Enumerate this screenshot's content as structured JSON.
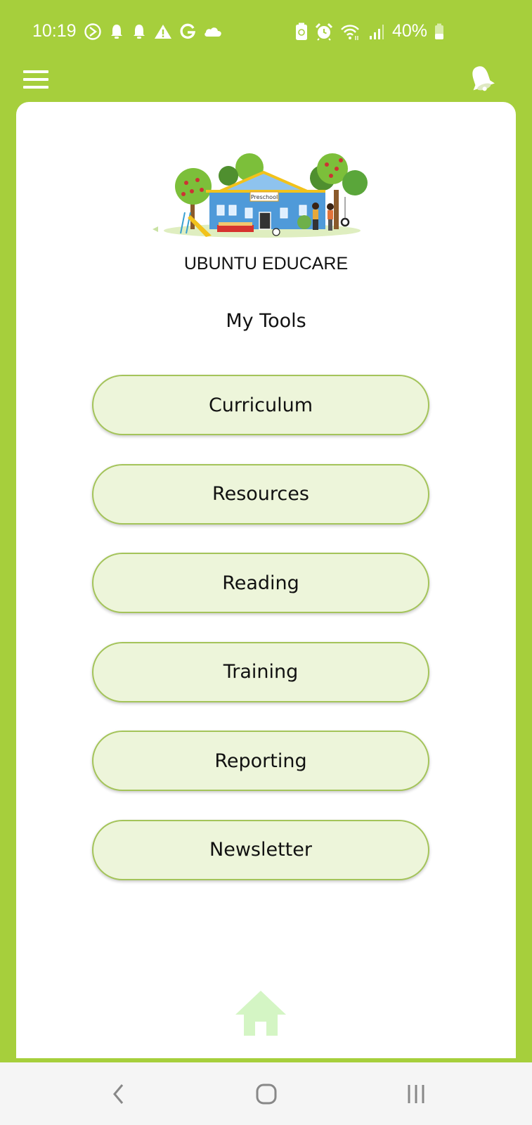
{
  "status_bar": {
    "time": "10:19",
    "left_icons": [
      "screen-record-icon",
      "bell-icon",
      "bell-icon",
      "warning-icon",
      "google-icon",
      "cloud-icon"
    ],
    "right_icons": [
      "battery-saver-icon",
      "alarm-icon",
      "wifi-icon",
      "signal-icon"
    ],
    "battery_percent": "40%",
    "battery_level": 0.4
  },
  "app_bar": {
    "menu_icon": "hamburger-menu-icon",
    "notification_icon": "bell-icon"
  },
  "header": {
    "logo_alt": "Preschool building illustration",
    "logo_sign": "Preschool",
    "org_name": "UBUNTU EDUCARE",
    "section_title": "My Tools"
  },
  "tools": [
    {
      "label": "Curriculum"
    },
    {
      "label": "Resources"
    },
    {
      "label": "Reading"
    },
    {
      "label": "Training"
    },
    {
      "label": "Reporting"
    },
    {
      "label": "Newsletter"
    }
  ],
  "bottom": {
    "home_icon": "home-icon"
  },
  "nav_bar": {
    "back": "back-icon",
    "home": "home-circle-icon",
    "recents": "recents-icon"
  },
  "colors": {
    "brand_green": "#a6cf3c",
    "button_fill": "#edf5da",
    "button_border": "#a4c45a",
    "home_icon": "#d4f5c4"
  }
}
